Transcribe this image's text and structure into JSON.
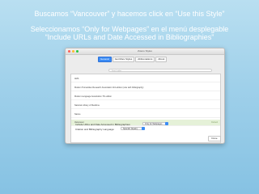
{
  "caption": {
    "line1": "Buscamos “Vancouver” y hacemos click en “Use this Style”",
    "line2": "Seleccionamos “Only for Webpages” en el menú desplegable",
    "line3": "“Include URLs and Date Accessed in Bibliographies”"
  },
  "window": {
    "title": "Zotero Styles",
    "tabs": [
      "General",
      "Get More Styles",
      "Abbreviations",
      "About"
    ],
    "search_placeholder": "Search styles",
    "styles": [
      "AMA",
      "Modern Humanities Research Association 3rd edition (note with bibliography)",
      "Modern Language Association 7th edition",
      "National Library of Medicine",
      "Nature",
      "Vancouver"
    ],
    "selected_style": "Vancouver",
    "selected_note": "Default",
    "include_urls_label": "Include URLs and Date Accessed in Bibliographies:",
    "include_urls_value": "Only for Webpages",
    "language_label": "Citation and Bibliography Language:",
    "language_value": "Spanish (Spain)",
    "done_label": "Done"
  }
}
